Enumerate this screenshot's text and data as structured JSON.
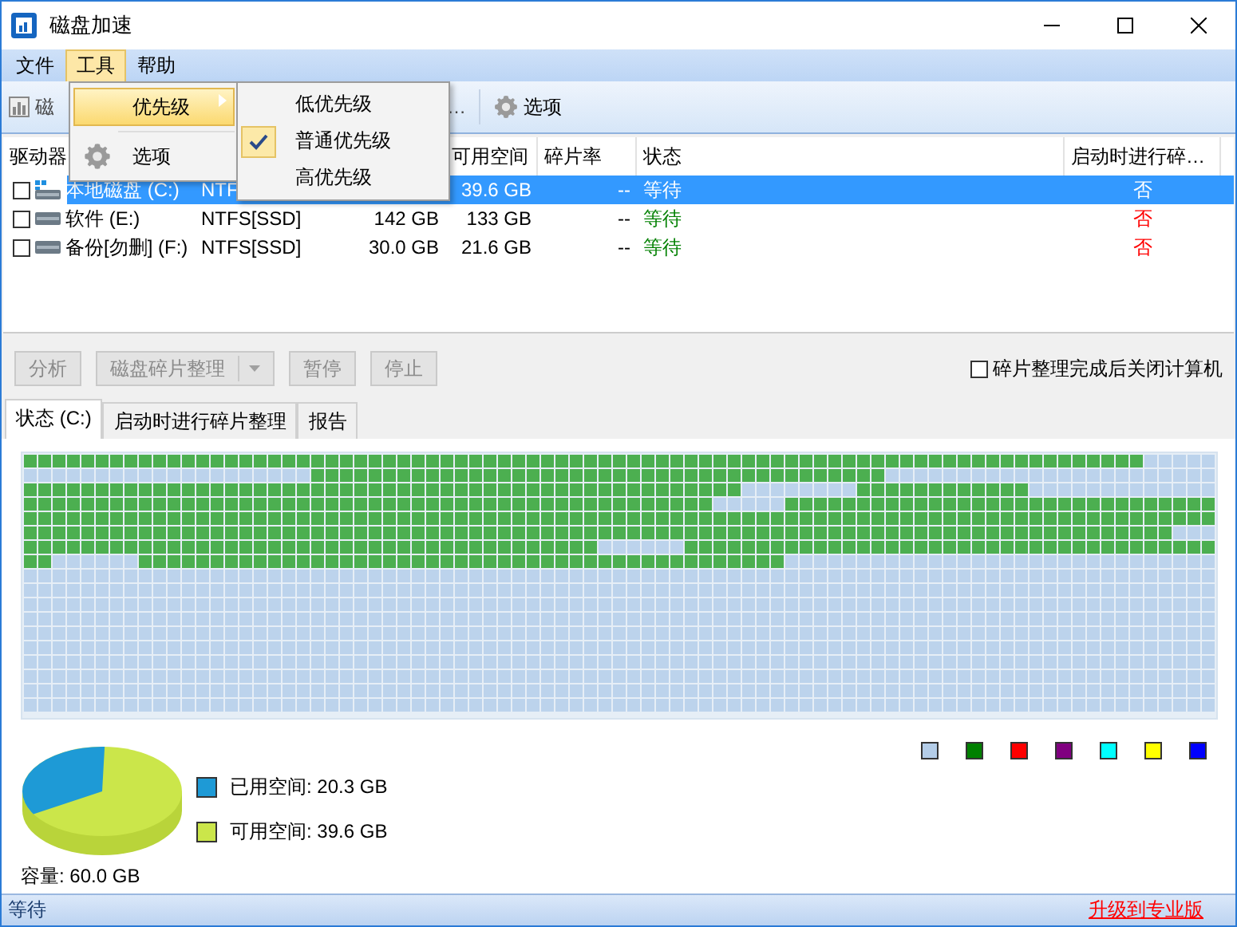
{
  "window": {
    "title": "磁盘加速"
  },
  "menu_bar": [
    {
      "label": "文件",
      "selected": false
    },
    {
      "label": "工具",
      "selected": true
    },
    {
      "label": "帮助",
      "selected": false
    }
  ],
  "tools_menu": {
    "items": [
      {
        "label": "优先级",
        "kind": "submenu",
        "selected": true
      },
      {
        "label": "选项",
        "kind": "gear",
        "selected": false
      }
    ],
    "submenu": [
      {
        "label": "低优先级",
        "checked": false
      },
      {
        "label": "普通优先级",
        "checked": true
      },
      {
        "label": "高优先级",
        "checked": false
      }
    ]
  },
  "toolbar": {
    "items": [
      "磁",
      "…"
    ],
    "options": "选项"
  },
  "table": {
    "columns": [
      "驱动器",
      "",
      "",
      "可用空间",
      "碎片率",
      "状态",
      "启动时进行碎…"
    ],
    "rows": [
      {
        "checked": false,
        "selected": true,
        "kind": "system",
        "name": "本地磁盘 (C:)",
        "fs": "NTF",
        "free": "39.6 GB",
        "frag": "--",
        "status": "等待",
        "boot": "否"
      },
      {
        "checked": false,
        "selected": false,
        "kind": "drive",
        "name": "软件 (E:)",
        "fs": "NTFS[SSD]",
        "size": "142 GB",
        "free": "133 GB",
        "frag": "--",
        "status": "等待",
        "boot": "否"
      },
      {
        "checked": false,
        "selected": false,
        "kind": "drive",
        "name": "备份[勿删] (F:)",
        "fs": "NTFS[SSD]",
        "size": "30.0 GB",
        "free": "21.6 GB",
        "frag": "--",
        "status": "等待",
        "boot": "否"
      }
    ]
  },
  "actions": [
    {
      "label": "分析",
      "disabled": true,
      "dropdown": false
    },
    {
      "label": "磁盘碎片整理",
      "disabled": true,
      "dropdown": true
    },
    {
      "label": "暂停",
      "disabled": true,
      "dropdown": false
    },
    {
      "label": "停止",
      "disabled": true,
      "dropdown": false
    }
  ],
  "shutdown_option": {
    "label": "碎片整理完成后关闭计算机",
    "checked": false
  },
  "tabs": [
    {
      "label": "状态 (C:)",
      "selected": true
    },
    {
      "label": "启动时进行碎片整理",
      "selected": false
    },
    {
      "label": "报告",
      "selected": false
    }
  ],
  "color_legend": [
    {
      "color": "#b4cde8"
    },
    {
      "color": "#008000"
    },
    {
      "color": "#ff0000"
    },
    {
      "color": "#800080"
    },
    {
      "color": "#00ffff"
    },
    {
      "color": "#ffff00"
    },
    {
      "color": "#0000ff"
    }
  ],
  "usage": {
    "legend": [
      {
        "label": "已用空间: 20.3 GB",
        "color": "#1e9ad6"
      },
      {
        "label": "可用空间: 39.6 GB",
        "color": "#cbe64a"
      }
    ],
    "capacity": "容量: 60.0 GB"
  },
  "status_bar": {
    "text": "等待",
    "link": "升级到专业版"
  }
}
